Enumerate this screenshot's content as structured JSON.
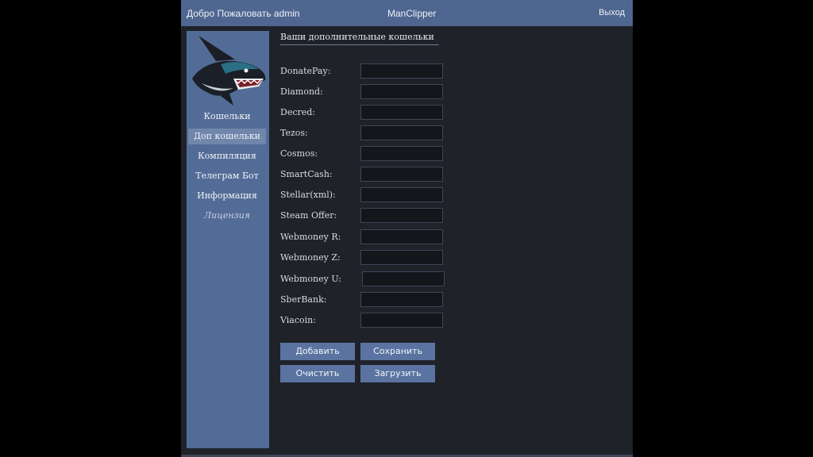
{
  "titlebar": {
    "welcome": "Добро Пожаловать  admin",
    "app_title": "ManClipper",
    "logout": "Выход"
  },
  "sidebar": {
    "logo": "shark-logo",
    "items": [
      {
        "label": "Кошельки"
      },
      {
        "label": "Доп кошельки"
      },
      {
        "label": "Компиляция"
      },
      {
        "label": "Телеграм Бот"
      },
      {
        "label": "Информация"
      },
      {
        "label": "Лицензия"
      }
    ]
  },
  "main": {
    "title": "Ваши дополнительные кошельки",
    "wallets": [
      {
        "label": "DonatePay:",
        "value": ""
      },
      {
        "label": "Diamond:",
        "value": ""
      },
      {
        "label": "Decred:",
        "value": ""
      },
      {
        "label": "Tezos:",
        "value": ""
      },
      {
        "label": "Cosmos:",
        "value": ""
      },
      {
        "label": "SmartCash:",
        "value": ""
      },
      {
        "label": "Stellar(xml):",
        "value": ""
      },
      {
        "label": "Steam Offer:",
        "value": ""
      },
      {
        "label": "Webmoney R:",
        "value": ""
      },
      {
        "label": "Webmoney Z:",
        "value": ""
      },
      {
        "label": "Webmoney U:",
        "value": ""
      },
      {
        "label": "SberBank:",
        "value": ""
      },
      {
        "label": "Viacoin:",
        "value": ""
      }
    ],
    "buttons": {
      "add": "Добавить",
      "save": "Сохранить",
      "clear": "Очистить",
      "load": "Загрузить"
    }
  },
  "colors": {
    "titlebar": "#4f6690",
    "sidebar": "#536c97",
    "sidebar_active": "#7086ab",
    "background": "#1f2229",
    "button": "#5a73a0"
  }
}
